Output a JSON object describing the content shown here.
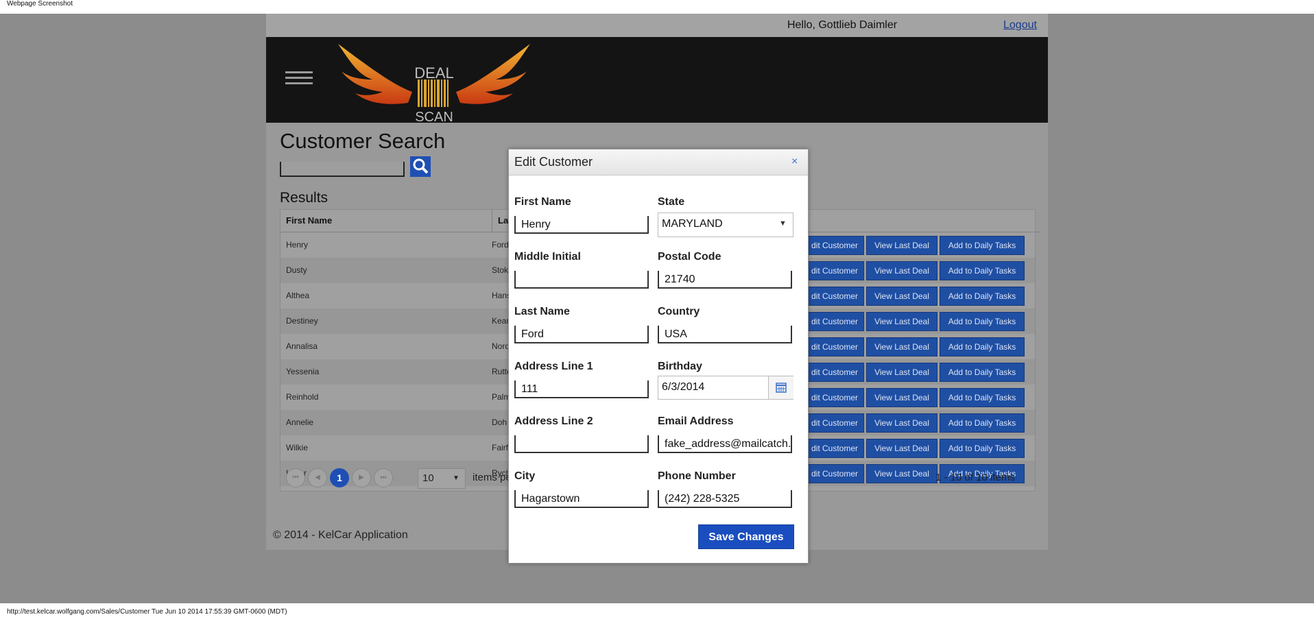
{
  "caption": "Webpage Screenshot",
  "status_bar": "http://test.kelcar.wolfgang.com/Sales/Customer Tue Jun 10 2014 17:55:39 GMT-0600 (MDT)",
  "header": {
    "greeting": "Hello, Gottlieb Daimler",
    "logout": "Logout",
    "logo_top": "DEAL",
    "logo_bottom": "SCAN"
  },
  "page": {
    "title": "Customer Search",
    "results_heading": "Results"
  },
  "grid": {
    "columns": [
      "First Name",
      "Las"
    ],
    "rows": [
      {
        "first": "Henry",
        "last": "Ford"
      },
      {
        "first": "Dusty",
        "last": "Stok"
      },
      {
        "first": "Althea",
        "last": "Hans"
      },
      {
        "first": "Destiney",
        "last": "Kear"
      },
      {
        "first": "Annalisa",
        "last": "Nord"
      },
      {
        "first": "Yessenia",
        "last": "Rutte"
      },
      {
        "first": "Reinhold",
        "last": "Palm"
      },
      {
        "first": "Annelie",
        "last": "Doh"
      },
      {
        "first": "Wilkie",
        "last": "Fairf"
      },
      {
        "first": "Levar",
        "last": "Rych"
      }
    ],
    "buttons": {
      "edit": "dit Customer",
      "view": "View Last Deal",
      "add": "Add to Daily Tasks"
    }
  },
  "pager": {
    "first": "⏮",
    "prev": "◀",
    "current": "1",
    "next": "▶",
    "last": "⏭",
    "page_size": "10",
    "page_size_arrow": "▼",
    "items_per": "items pe",
    "count": "1 - 10 of 10 items"
  },
  "footer": "© 2014 - KelCar Application",
  "modal": {
    "title": "Edit Customer",
    "close": "×",
    "labels": {
      "first_name": "First Name",
      "middle_initial": "Middle Initial",
      "last_name": "Last Name",
      "address1": "Address Line 1",
      "address2": "Address Line 2",
      "city": "City",
      "state": "State",
      "postal": "Postal Code",
      "country": "Country",
      "birthday": "Birthday",
      "email": "Email Address",
      "phone": "Phone Number"
    },
    "values": {
      "first_name": "Henry",
      "middle_initial": "",
      "last_name": "Ford",
      "address1": "111",
      "address2": "",
      "city": "Hagarstown",
      "state": "MARYLAND",
      "postal": "21740",
      "country": "USA",
      "birthday": "6/3/2014",
      "email": "fake_address@mailcatch.",
      "phone": "(242) 228-5325"
    },
    "state_arrow": "▼",
    "save": "Save Changes"
  },
  "colors": {
    "accent": "#1f4fa3",
    "header_bg": "#141414",
    "overlay": "#999999"
  },
  "icons": [
    "search-icon",
    "calendar-icon",
    "hamburger-menu-icon",
    "close-icon",
    "logo-wings-icon"
  ]
}
